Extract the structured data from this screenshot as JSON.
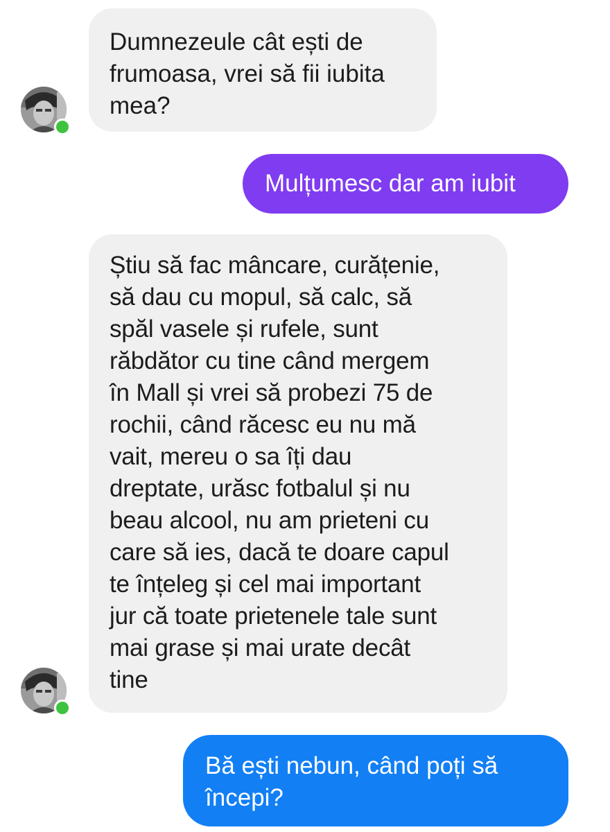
{
  "conversation": {
    "messages": [
      {
        "sender": "other",
        "text": "Dumnezeule cât ești de\nfrumoasa, vrei să fii iubita\nmea?"
      },
      {
        "sender": "me",
        "text": "Mulțumesc dar am iubit"
      },
      {
        "sender": "other",
        "text": "Știu să fac mâncare, curățenie,\nsă dau cu mopul, să calc, să\nspăl vasele și rufele, sunt\nrăbdător cu tine când mergem\nîn Mall și vrei să probezi 75 de\nrochii, când răcesc eu nu mă\nvait, mereu o sa îți dau\ndreptate, urăsc fotbalul și nu\nbeau alcool, nu am prieteni cu\ncare să ies, dacă te doare capul\nte înțeleg și cel mai important\njur că toate prietenele tale sunt\nmai grase și mai urate decât\ntine"
      },
      {
        "sender": "me",
        "text": "Bă ești nebun, când poți să\nîncepi?"
      }
    ]
  },
  "colors": {
    "incoming_bubble": "#f0f0f0",
    "outgoing_purple": "#7f3cf0",
    "outgoing_blue": "#127ff5",
    "online_indicator": "#3fc33f"
  },
  "icons": {
    "contact_avatar": "contact-avatar",
    "online_status": "online-status-icon"
  }
}
